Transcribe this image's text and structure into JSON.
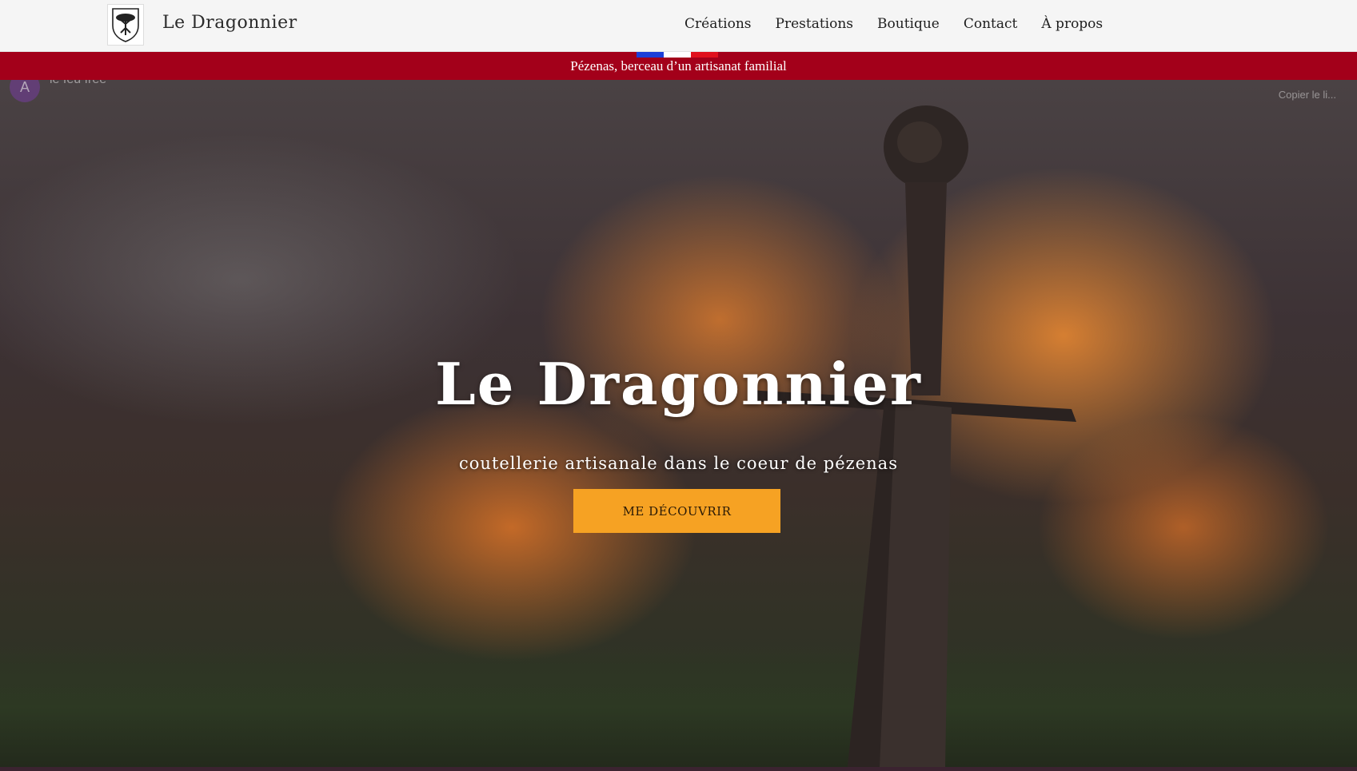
{
  "header": {
    "site_name": "Le Dragonnier",
    "nav": [
      "Créations",
      "Prestations",
      "Boutique",
      "Contact",
      "À propos"
    ]
  },
  "banner": {
    "text": "Pézenas, berceau d’un artisanat familial",
    "flag_colors": [
      "#1d3fd8",
      "#ffffff",
      "#e0101d"
    ]
  },
  "video_overlay": {
    "avatar_letter": "A",
    "title": "le feu free",
    "copy_link": "Copier le li..."
  },
  "hero": {
    "title": "Le Dragonnier",
    "subtitle": "coutellerie artisanale dans le coeur de pézenas",
    "cta_label": "ME DÉCOUVRIR"
  },
  "colors": {
    "banner": "#a3001a",
    "cta": "#f6a223",
    "header_bg": "#f5f5f5"
  }
}
